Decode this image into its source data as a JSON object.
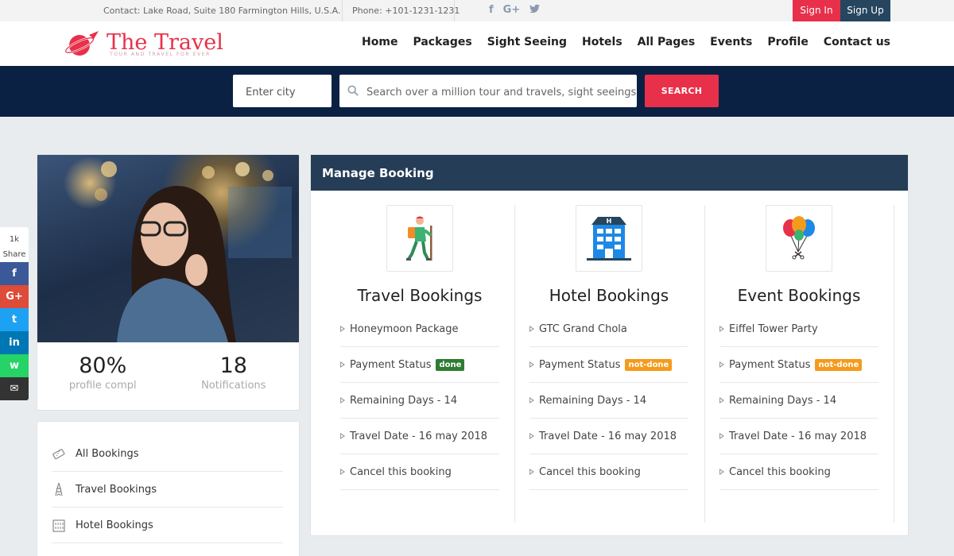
{
  "topbar": {
    "contact": "Contact: Lake Road, Suite 180 Farmington Hills, U.S.A.",
    "phone": "Phone: +101-1231-1231",
    "signin": "Sign In",
    "signup": "Sign Up",
    "social": [
      "facebook-icon",
      "google-plus-icon",
      "twitter-icon"
    ]
  },
  "logo": {
    "title": "The Travel",
    "tagline": "TOUR AND TRAVEL FOR EVER"
  },
  "nav": [
    "Home",
    "Packages",
    "Sight Seeing",
    "Hotels",
    "All Pages",
    "Events",
    "Profile",
    "Contact us"
  ],
  "search": {
    "city_placeholder": "Enter city",
    "query_placeholder": "Search over a million tour and travels, sight seeings, hotels and more",
    "button": "SEARCH"
  },
  "profile": {
    "completion": "80%",
    "completion_label": "profile compl",
    "notifications": "18",
    "notifications_label": "Notifications"
  },
  "sidemenu": [
    "All Bookings",
    "Travel Bookings",
    "Hotel Bookings"
  ],
  "share": {
    "count": "1k",
    "label": "Share",
    "buttons": [
      {
        "icon": "facebook-icon",
        "glyph": "f",
        "color": "#3b5998"
      },
      {
        "icon": "google-plus-icon",
        "glyph": "G+",
        "color": "#dd4b39"
      },
      {
        "icon": "twitter-icon",
        "glyph": "t",
        "color": "#1da1f2"
      },
      {
        "icon": "linkedin-icon",
        "glyph": "in",
        "color": "#0077b5"
      },
      {
        "icon": "whatsapp-icon",
        "glyph": "w",
        "color": "#25d366"
      },
      {
        "icon": "email-icon",
        "glyph": "✉",
        "color": "#333333"
      }
    ]
  },
  "manage": {
    "title": "Manage Booking",
    "columns": [
      {
        "title": "Travel Bookings",
        "icon": "hiker-icon",
        "item": "Honeymoon Package",
        "payment_label": "Payment Status",
        "payment_status": "done",
        "remaining": "Remaining Days - 14",
        "date": "Travel Date - 16 may 2018",
        "cancel": "Cancel this booking"
      },
      {
        "title": "Hotel Bookings",
        "icon": "hotel-icon",
        "item": "GTC Grand Chola",
        "payment_label": "Payment Status",
        "payment_status": "not-done",
        "remaining": "Remaining Days - 14",
        "date": "Travel Date - 16 may 2018",
        "cancel": "Cancel this booking"
      },
      {
        "title": "Event Bookings",
        "icon": "balloons-icon",
        "item": "Eiffel Tower Party",
        "payment_label": "Payment Status",
        "payment_status": "not-done",
        "remaining": "Remaining Days - 14",
        "date": "Travel Date - 16 may 2018",
        "cancel": "Cancel this booking"
      }
    ]
  },
  "colors": {
    "accent": "#e8304a",
    "navy": "#0b2144",
    "panel_header": "#253d56",
    "done": "#2e7d32",
    "not_done": "#f59b1c"
  }
}
